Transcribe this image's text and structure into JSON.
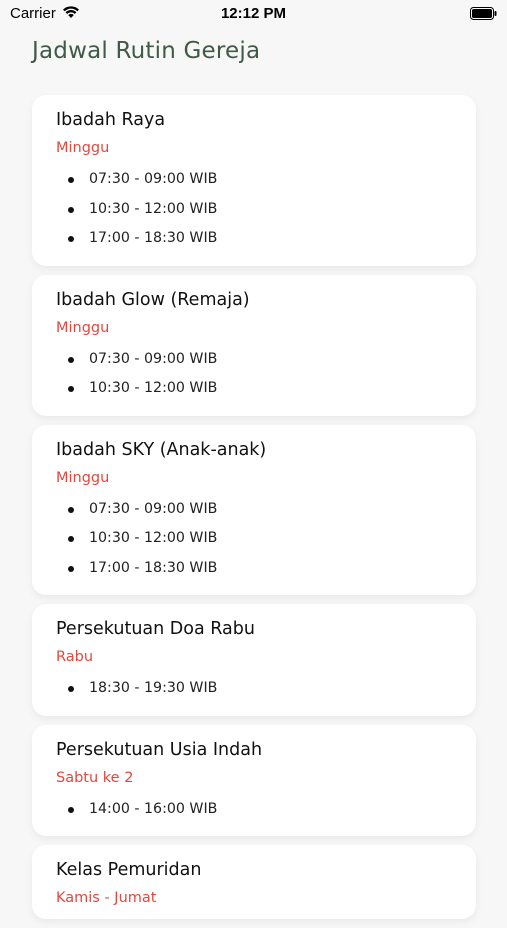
{
  "status_bar": {
    "carrier": "Carrier",
    "time": "12:12 PM"
  },
  "header": {
    "title": "Jadwal Rutin Gereja"
  },
  "schedules": [
    {
      "title": "Ibadah Raya",
      "day": "Minggu",
      "times": [
        "07:30 - 09:00 WIB",
        "10:30 - 12:00 WIB",
        "17:00 - 18:30 WIB"
      ]
    },
    {
      "title": "Ibadah Glow (Remaja)",
      "day": "Minggu",
      "times": [
        "07:30 - 09:00 WIB",
        "10:30 - 12:00 WIB"
      ]
    },
    {
      "title": "Ibadah SKY (Anak-anak)",
      "day": "Minggu",
      "times": [
        "07:30 - 09:00 WIB",
        "10:30 - 12:00 WIB",
        "17:00 - 18:30 WIB"
      ]
    },
    {
      "title": "Persekutuan Doa Rabu",
      "day": "Rabu",
      "times": [
        "18:30 - 19:30 WIB"
      ]
    },
    {
      "title": "Persekutuan Usia Indah",
      "day": "Sabtu ke 2",
      "times": [
        "14:00 - 16:00 WIB"
      ]
    },
    {
      "title": "Kelas Pemuridan",
      "day": "Kamis - Jumat",
      "times": []
    }
  ],
  "colors": {
    "title": "#3f5a46",
    "day": "#e2483e",
    "background": "#f7f7f7"
  },
  "icons": {
    "wifi": "wifi-icon",
    "battery": "battery-icon"
  }
}
